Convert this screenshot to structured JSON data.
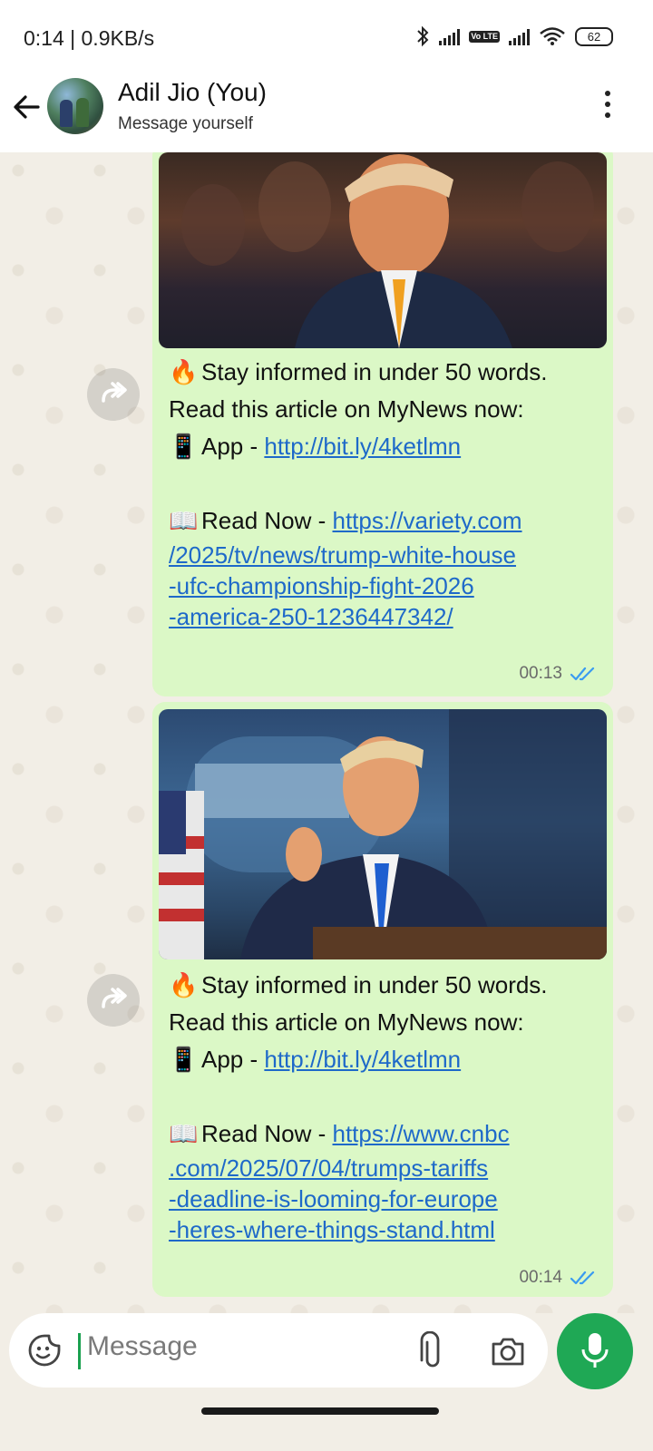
{
  "status_bar": {
    "time": "0:14 | 0.9KB/s",
    "battery": "62",
    "volte": "Vo LTE",
    "icons": [
      "bluetooth-icon",
      "signal-icon",
      "volte-icon",
      "signal-icon",
      "wifi-icon",
      "battery-icon"
    ]
  },
  "header": {
    "title": "Adil Jio (You)",
    "subtitle": "Message yourself",
    "back_icon": "arrow-left-icon",
    "menu_icon": "more-vertical-icon"
  },
  "messages": [
    {
      "intro": "Stay informed in under 50 words.",
      "line2": "Read this article on MyNews now:",
      "app_label": "App - ",
      "app_link": "http://bit.ly/4ketlmn",
      "read_label": "Read Now - ",
      "read_link_lines": [
        "https://variety.com",
        "/2025/tv/news/trump-white-house",
        "-ufc-championship-fight-2026",
        "-america-250-1236447342/"
      ],
      "time": "00:13",
      "status": "read-double-tick"
    },
    {
      "intro": "Stay informed in under 50 words.",
      "line2": "Read this article on MyNews now:",
      "app_label": "App - ",
      "app_link": "http://bit.ly/4ketlmn",
      "read_label": "Read Now - ",
      "read_link_lines": [
        "https://www.cnbc",
        ".com/2025/07/04/trumps-tariffs",
        "-deadline-is-looming-for-europe",
        "-heres-where-things-stand.html"
      ],
      "time": "00:14",
      "status": "read-double-tick"
    }
  ],
  "composer": {
    "placeholder": "Message",
    "icons": [
      "sticker-icon",
      "attach-icon",
      "camera-icon",
      "mic-icon"
    ]
  },
  "colors": {
    "bubble": "#dbf8c6",
    "link": "#1e69c9",
    "tick": "#3a9bf0",
    "mic": "#1fa855",
    "chat_bg": "#f2eee6"
  }
}
